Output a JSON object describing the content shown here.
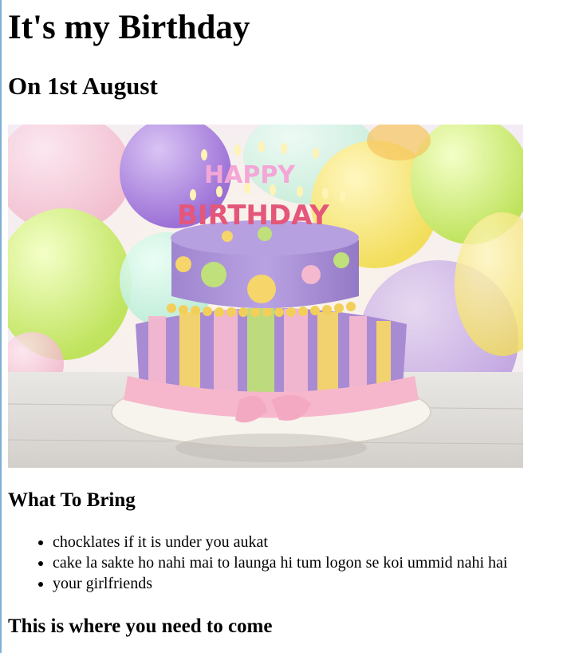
{
  "page": {
    "title": "It's my Birthday",
    "subtitle": "On 1st August",
    "image": {
      "description": "cake-photo",
      "cake_text_top": "HAPPY",
      "cake_text_bottom": "BIRTHDAY"
    },
    "bring_heading": "What To Bring",
    "bring_items": [
      "chocklates if it is under you aukat",
      "cake la sakte ho nahi mai to launga hi tum logon se koi ummid nahi hai",
      "your girlfriends"
    ],
    "where_heading": "This is where you need to come"
  },
  "colors": {
    "left_rule": "#7fb0d8",
    "cake_purple": "#a98bd4",
    "cake_pink": "#f4b8cf",
    "cake_yellow": "#f6d56a",
    "cake_green": "#bfe07a"
  }
}
